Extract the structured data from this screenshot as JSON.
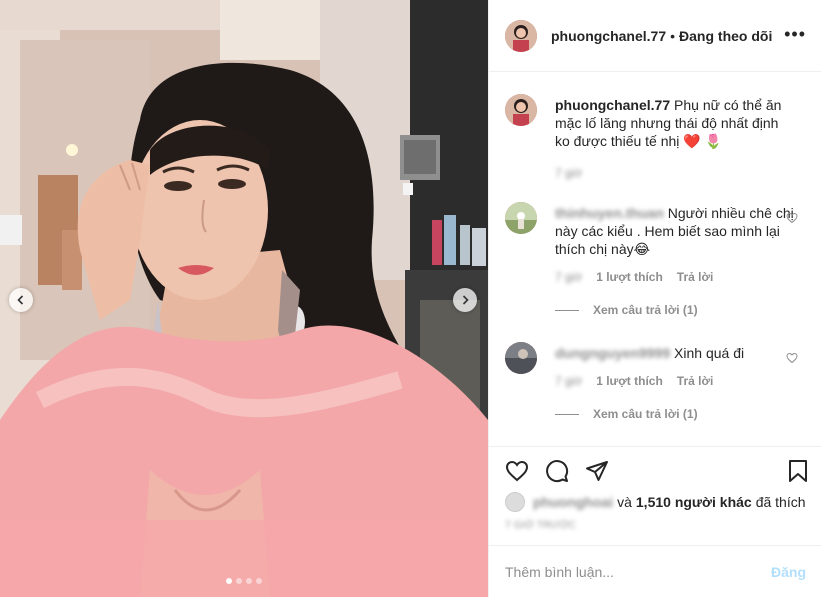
{
  "post": {
    "author": "phuongchanel.77",
    "separator": "•",
    "follow_status": "Đang theo dõi",
    "more_label": "•••"
  },
  "caption": {
    "username": "phuongchanel.77",
    "text": "Phụ nữ có thể ăn mặc lố lăng nhưng thái độ nhất định ko được thiếu tế nhị ❤️ 🌷",
    "time": "7 giờ"
  },
  "comments": [
    {
      "username": "thinhuyen.thuan",
      "text": "Người nhiều chê chị này các kiểu . Hem biết sao mình lại thích chị này😂",
      "time": "7 giờ",
      "likes": "1 lượt thích",
      "reply": "Trả lời",
      "view_replies": "Xem câu trả lời (1)"
    },
    {
      "username": "dungnguyen9999",
      "text": "Xinh quá đi",
      "time": "7 giờ",
      "likes": "1 lượt thích",
      "reply": "Trả lời",
      "view_replies": "Xem câu trả lời (1)"
    }
  ],
  "likes": {
    "first_user": "phuonghoai",
    "connector": "và",
    "others": "1,510 người khác",
    "suffix": "đã thích"
  },
  "timestamp": "7 GIỜ TRƯỚC",
  "add_comment": {
    "placeholder": "Thêm bình luận...",
    "post_label": "Đăng"
  },
  "carousel": {
    "slide_count": 4,
    "active_index": 0
  },
  "colors": {
    "text": "#262626",
    "muted": "#8e8e8e",
    "border": "#efefef",
    "post_button_disabled": "#b2dffc"
  },
  "icons": [
    "heart-icon",
    "comment-icon",
    "share-icon",
    "bookmark-icon",
    "chevron-left-icon",
    "chevron-right-icon",
    "more-icon"
  ]
}
